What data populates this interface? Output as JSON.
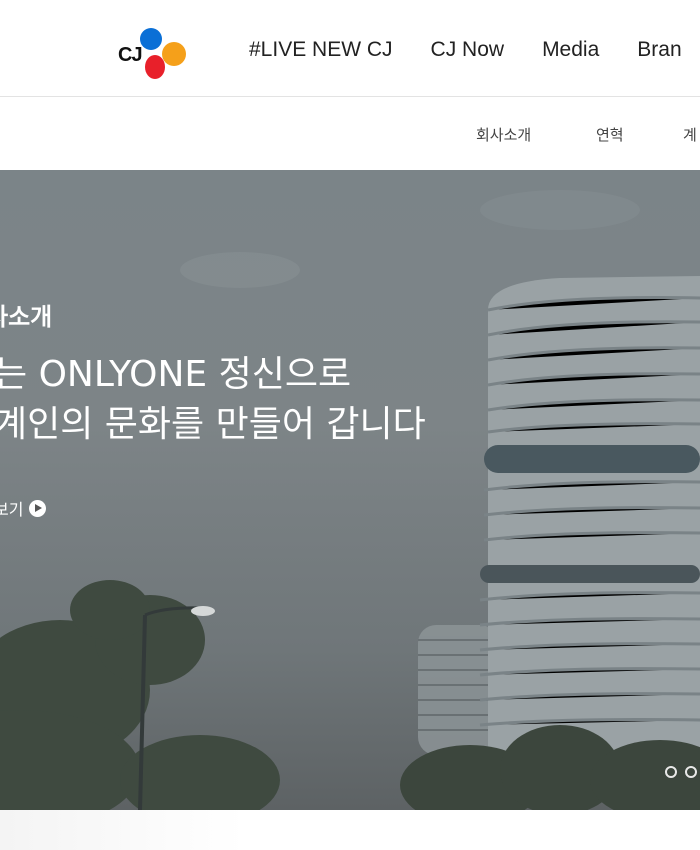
{
  "header": {
    "logo_text": "CJ",
    "nav": [
      {
        "label": "#LIVE NEW CJ"
      },
      {
        "label": "CJ Now"
      },
      {
        "label": "Media"
      },
      {
        "label": "Bran"
      }
    ]
  },
  "subnav": {
    "items": [
      {
        "label": "회사소개"
      },
      {
        "label": "연혁"
      },
      {
        "label": "계"
      }
    ]
  },
  "hero": {
    "eyebrow": "사소개",
    "title_line1": "는 ONLYONE 정신으로",
    "title_line2": "계인의 문화를 만들어 갑니다",
    "more_label": "보기",
    "slide_count": 2
  },
  "colors": {
    "logo_blue": "#0a6fd6",
    "logo_orange": "#f5a01a",
    "logo_red": "#e8202a"
  }
}
